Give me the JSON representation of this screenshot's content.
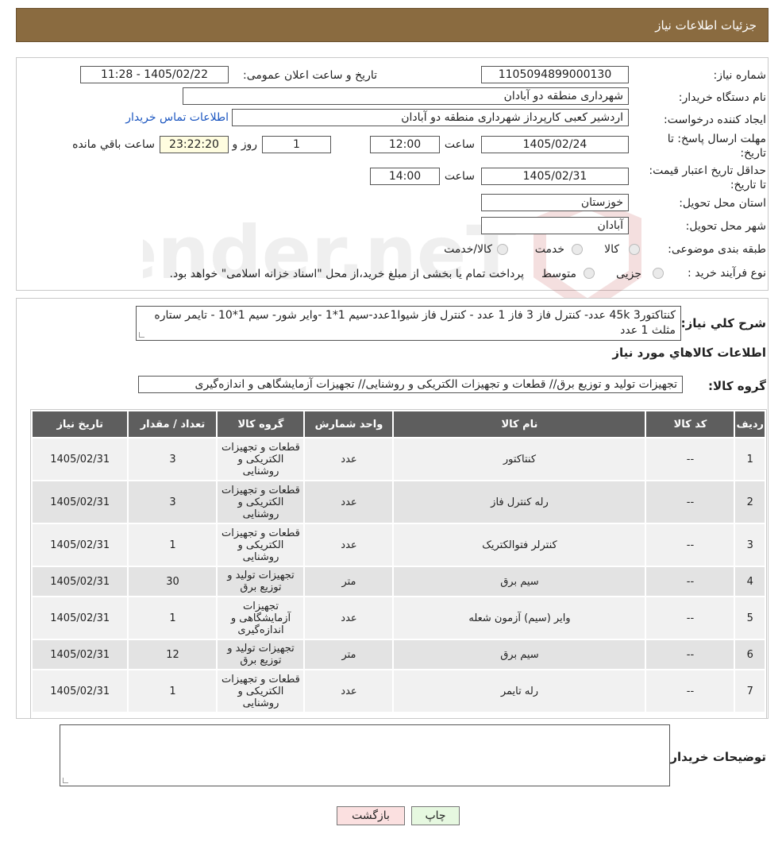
{
  "header": {
    "title": "جزئیات اطلاعات نیاز"
  },
  "info": {
    "need_number_label": "شماره نیاز:",
    "need_number": "1105094899000130",
    "announce_label": "تاریخ و ساعت اعلان عمومی:",
    "announce_value": "1405/02/22 - 11:28",
    "buyer_org_label": "نام دستگاه خریدار:",
    "buyer_org": "شهرداری منطقه دو آبادان",
    "requester_label": "ایجاد کننده درخواست:",
    "requester": "اردشیر کعبی کارپرداز شهرداری منطقه دو آبادان",
    "contact_link": "اطلاعات تماس خریدار",
    "reply_deadline_label": "مهلت ارسال پاسخ: تا تاریخ:",
    "reply_date": "1405/02/24",
    "time_label": "ساعت",
    "reply_time": "12:00",
    "days_value": "1",
    "day_and_label": "روز و",
    "remaining_value": "23:22:20",
    "remaining_label": "ساعت باقي مانده",
    "validity_label": "حداقل تاریخ اعتبار قیمت: تا تاریخ:",
    "validity_date": "1405/02/31",
    "validity_time": "14:00",
    "province_label": "استان محل تحویل:",
    "province": "خوزستان",
    "city_label": "شهر محل تحویل:",
    "city": "آبادان",
    "category_label": "طبقه بندی موضوعی:",
    "category_options": [
      "کالا",
      "خدمت",
      "کالا/خدمت"
    ],
    "process_label": "نوع فرآیند خرید :",
    "process_options": [
      "جزیی",
      "متوسط"
    ],
    "process_note": "پرداخت تمام یا بخشی از مبلغ خرید،از محل \"اسناد خزانه اسلامی\" خواهد بود."
  },
  "description": {
    "label": "شرح کلي نياز:",
    "text": "کنتاکتور3 45k عدد- کنترل فاز 3 فاز 1 عدد - کنترل فاز شیوا1عدد-سیم 1*1  -وایر شور- سیم 1*10 - تایمر ستاره مثلث 1 عدد"
  },
  "goods": {
    "section_title": "اطلاعات کالاهاي مورد نياز",
    "group_label": "گروه کالا:",
    "group_value": "تجهیزات تولید و توزیع برق// قطعات و تجهیزات الکتریکی و روشنایی// تجهیزات آزمایشگاهی و اندازه‌گیری"
  },
  "table": {
    "headers": [
      "رديف",
      "کد کالا",
      "نام کالا",
      "واحد شمارش",
      "گروه کالا",
      "تعداد / مقدار",
      "تاريخ نياز"
    ],
    "rows": [
      [
        "1",
        "--",
        "کنتاکتور",
        "عدد",
        "قطعات و تجهیزات الکتریکی و روشنایی",
        "3",
        "1405/02/31"
      ],
      [
        "2",
        "--",
        "رله کنترل فاز",
        "عدد",
        "قطعات و تجهیزات الکتریکی و روشنایی",
        "3",
        "1405/02/31"
      ],
      [
        "3",
        "--",
        "کنترلر فتوالکتریک",
        "عدد",
        "قطعات و تجهیزات الکتریکی و روشنایی",
        "1",
        "1405/02/31"
      ],
      [
        "4",
        "--",
        "سیم برق",
        "متر",
        "تجهیزات تولید و توزیع برق",
        "30",
        "1405/02/31"
      ],
      [
        "5",
        "--",
        "وایر (سیم) آزمون شعله",
        "عدد",
        "تجهیزات آزمایشگاهی و اندازه‌گیری",
        "1",
        "1405/02/31"
      ],
      [
        "6",
        "--",
        "سیم برق",
        "متر",
        "تجهیزات تولید و توزیع برق",
        "12",
        "1405/02/31"
      ],
      [
        "7",
        "--",
        "رله تایمر",
        "عدد",
        "قطعات و تجهیزات الکتریکی و روشنایی",
        "1",
        "1405/02/31"
      ]
    ]
  },
  "buyer_notes": {
    "label": "توضيحات خريدار:",
    "value": ""
  },
  "buttons": {
    "print": "چاپ",
    "back": "بازگشت"
  },
  "colors": {
    "header_bg": "#8a6b40",
    "table_header_bg": "#5e5e5e",
    "print_bg": "#e6f8e0",
    "back_bg": "#fbe0e0"
  }
}
